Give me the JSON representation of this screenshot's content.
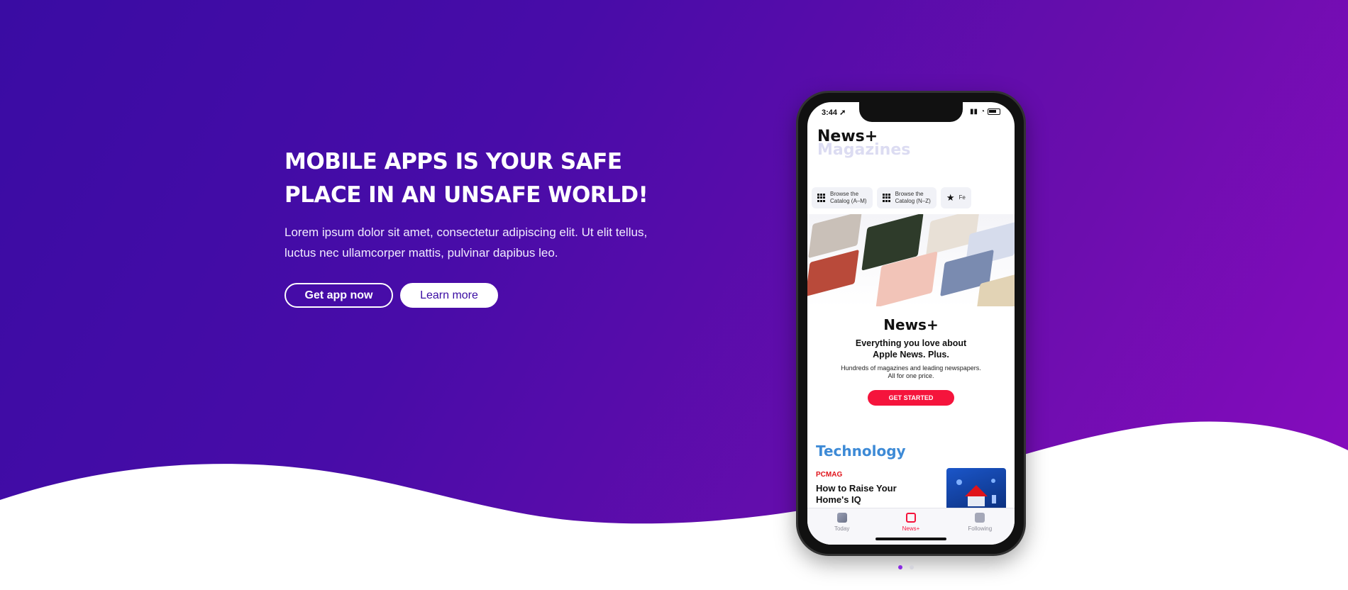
{
  "hero": {
    "title_line1": "MOBILE APPS IS YOUR SAFE",
    "title_line2": "PLACE IN AN UNSAFE WORLD!",
    "description_line1": "Lorem ipsum dolor sit amet, consectetur adipiscing elit. Ut elit tellus,",
    "description_line2": "luctus nec ullamcorper mattis, pulvinar dapibus leo.",
    "primary_button": "Get app now",
    "secondary_button": "Learn more"
  },
  "phone": {
    "status_time": "3:44",
    "app_title": "News+",
    "app_subtitle": "Magazines",
    "chips": [
      {
        "line1": "Browse the",
        "line2": "Catalog (A–M)"
      },
      {
        "line1": "Browse the",
        "line2": "Catalog (N–Z)"
      },
      {
        "line1": "Fe",
        "line2": ""
      }
    ],
    "promo": {
      "logo": "News+",
      "tagline_line1": "Everything you love about",
      "tagline_line2": "Apple News. Plus.",
      "small_line1": "Hundreds of magazines and leading newspapers.",
      "small_line2": "All for one price.",
      "cta": "GET STARTED"
    },
    "section_title": "Technology",
    "article": {
      "publication": "PCMAG",
      "headline_line1": "How to Raise Your",
      "headline_line2": "Home's IQ"
    },
    "tabs": [
      {
        "label": "Today",
        "active": false
      },
      {
        "label": "News+",
        "active": true
      },
      {
        "label": "Following",
        "active": false
      }
    ]
  },
  "carousel": {
    "slide_count": 2,
    "active_index": 0
  },
  "colors": {
    "gradient_start": "#3a0ca3",
    "gradient_end": "#8a0cc0",
    "cta_red": "#f5143c",
    "tech_blue": "#3d8ad6"
  }
}
